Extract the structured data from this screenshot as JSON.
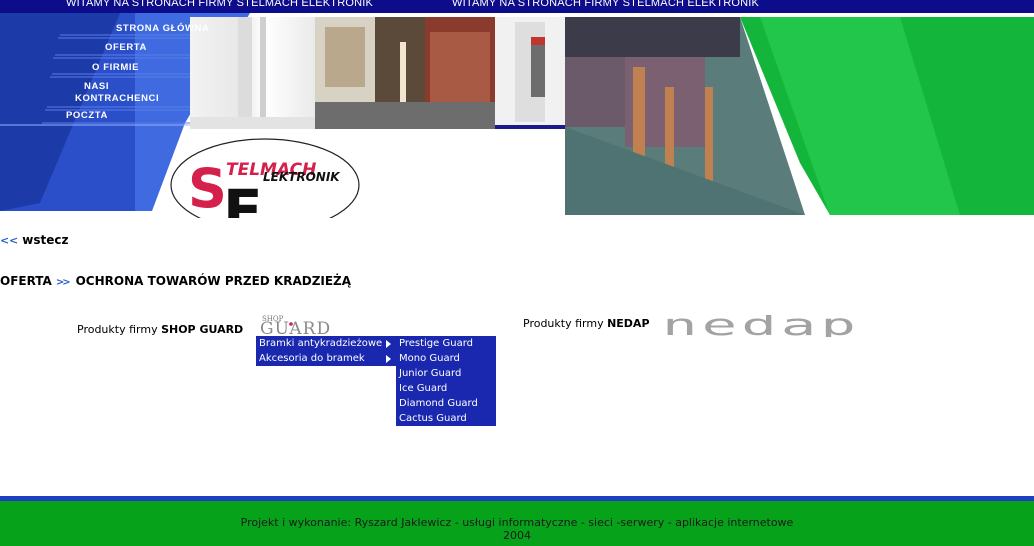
{
  "marquee": {
    "text_a": "WITAMY NA STRONACH FIRMY STELMACH ELEKTRONIK",
    "text_b": "WITAMY NA STRONACH FIRMY STELMACH ELEKTRONIK"
  },
  "nav": {
    "items": [
      {
        "label": "STRONA GŁÓWNA"
      },
      {
        "label": "OFERTA"
      },
      {
        "label": "O FIRMIE"
      },
      {
        "label_line1": "NASI",
        "label_line2": "KONTRACHENCI"
      },
      {
        "label": "POCZTA"
      }
    ]
  },
  "logo": {
    "line1": "TELMACH",
    "line2": "LEKTRONIK",
    "s": "S",
    "e": "E"
  },
  "back_link": {
    "label": "wstecz",
    "arrows": "< <"
  },
  "breadcrumb": {
    "root": "OFERTA",
    "sep": ">>",
    "current": "OCHRONA TOWARÓW PRZED KRADZIEŻĄ"
  },
  "producers": {
    "shop": {
      "prefix": "Produkty firmy ",
      "name": "SHOP GUARD",
      "logo_top": "SHOP",
      "logo_main": "GUARD"
    },
    "nedap": {
      "prefix": "Produkty firmy ",
      "name": "NEDAP",
      "logo": "nedap"
    }
  },
  "dropdown": {
    "level1": [
      {
        "label": "Bramki antykradzieżowe",
        "has_submenu": true
      },
      {
        "label": "Akcesoria do bramek",
        "has_submenu": true
      }
    ],
    "level2": [
      {
        "label": "Prestige Guard"
      },
      {
        "label": "Mono Guard"
      },
      {
        "label": "Junior Guard"
      },
      {
        "label": "Ice Guard"
      },
      {
        "label": "Diamond Guard"
      },
      {
        "label": "Cactus Guard"
      }
    ]
  },
  "footer": {
    "line1": "Projekt i wykonanie: Ryszard Jaklewicz - usługi informatyczne - sieci -serwery - aplikacje internetowe",
    "line2": "2004"
  },
  "colors": {
    "topbar": "#0d0d8c",
    "menu_blue": "#2a4fc8",
    "green": "#13b63a",
    "dropdown": "#1a28b0",
    "footer": "#06a21a"
  }
}
